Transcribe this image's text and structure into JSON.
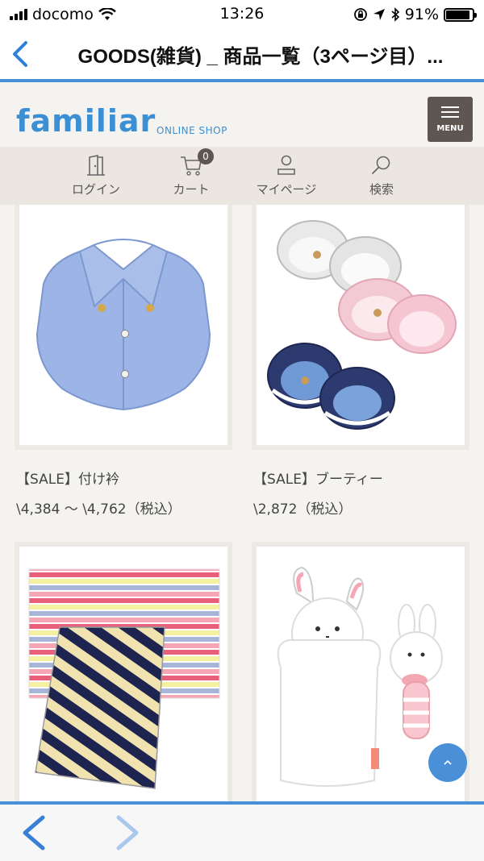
{
  "status_bar": {
    "carrier": "docomo",
    "time": "13:26",
    "battery": "91%",
    "battery_level": 0.91
  },
  "nav": {
    "title": "GOODS(雑貨) _ 商品一覧（3ページ目）..."
  },
  "site": {
    "logo": "familiar",
    "logo_sub": "ONLINE SHOP",
    "menu_label": "MENU"
  },
  "icon_nav": {
    "items": [
      {
        "label": "ログイン",
        "icon": "login-door-icon"
      },
      {
        "label": "カート",
        "icon": "cart-icon",
        "badge": "0"
      },
      {
        "label": "マイページ",
        "icon": "user-icon"
      },
      {
        "label": "検索",
        "icon": "search-icon"
      }
    ]
  },
  "products": [
    {
      "name": "【SALE】付け衿",
      "price": "\\4,384 〜 \\4,762（税込）",
      "image": "blue-shirt-collar"
    },
    {
      "name": "【SALE】ブーティー",
      "price": "\\2,872（税込）",
      "image": "baby-booties"
    },
    {
      "name": "",
      "price": "",
      "image": "striped-blankets"
    },
    {
      "name": "",
      "price": "",
      "image": "bunny-puppet-and-rattle"
    }
  ],
  "colors": {
    "accent": "#4a90d9",
    "brand": "#3b8fd4",
    "menu_bg": "#5e5650",
    "page_bg": "#f5f3ef"
  }
}
